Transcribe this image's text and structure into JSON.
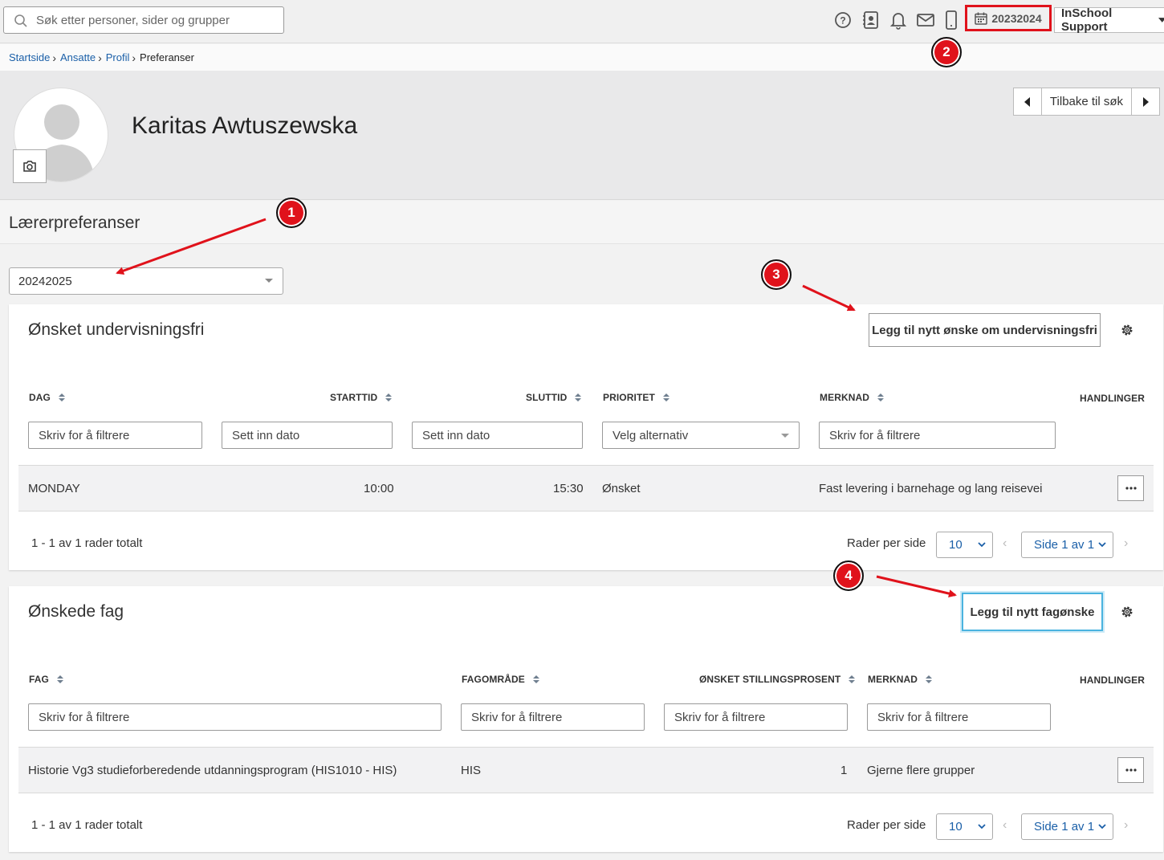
{
  "topbar": {
    "search_placeholder": "Søk etter personer, sider og grupper",
    "icons": [
      "help-icon",
      "contact-card-icon",
      "bell-icon",
      "mail-icon",
      "phone-icon",
      "calendar-icon"
    ],
    "school_year": "20232024",
    "user_menu_label": "InSchool Support"
  },
  "breadcrumb": {
    "items": [
      "Startside",
      "Ansatte",
      "Profil"
    ],
    "current": "Preferanser"
  },
  "profile": {
    "name": "Karitas Awtuszewska",
    "nav_back_label": "Tilbake til søk"
  },
  "section": {
    "title": "Lærerpreferanser",
    "year_select_value": "20242025"
  },
  "undervisningsfri": {
    "title": "Ønsket undervisningsfri",
    "add_button": "Legg til nytt ønske om undervisningsfri",
    "columns": [
      "DAG",
      "STARTTID",
      "SLUTTID",
      "PRIORITET",
      "MERKNAD",
      "HANDLINGER"
    ],
    "filters": {
      "dag": "Skriv for å filtrere",
      "starttid": "Sett inn dato",
      "sluttid": "Sett inn dato",
      "prioritet": "Velg alternativ",
      "merknad": "Skriv for å filtrere"
    },
    "rows": [
      {
        "dag": "MONDAY",
        "starttid": "10:00",
        "sluttid": "15:30",
        "prioritet": "Ønsket",
        "merknad": "Fast levering i barnehage og lang reisevei"
      }
    ],
    "footer": {
      "total": "1 - 1 av 1 rader totalt",
      "rows_per_page_label": "Rader per side",
      "rows_per_page": "10",
      "page": "Side 1 av 1"
    }
  },
  "fag": {
    "title": "Ønskede fag",
    "add_button": "Legg til nytt fagønske",
    "columns": [
      "FAG",
      "FAGOMRÅDE",
      "ØNSKET STILLINGSPROSENT",
      "MERKNAD",
      "HANDLINGER"
    ],
    "filters": {
      "fag": "Skriv for å filtrere",
      "fagomrade": "Skriv for å filtrere",
      "stillingsprosent": "Skriv for å filtrere",
      "merknad": "Skriv for å filtrere"
    },
    "rows": [
      {
        "fag": "Historie Vg3 studieforberedende utdanningsprogram (HIS1010 - HIS)",
        "fagomrade": "HIS",
        "stillingsprosent": "1",
        "merknad": "Gjerne flere grupper"
      }
    ],
    "footer": {
      "total": "1 - 1 av 1 rader totalt",
      "rows_per_page_label": "Rader per side",
      "rows_per_page": "10",
      "page": "Side 1 av 1"
    }
  },
  "annotations": {
    "badges": [
      "1",
      "2",
      "3",
      "4"
    ],
    "color": "#e0121b"
  }
}
